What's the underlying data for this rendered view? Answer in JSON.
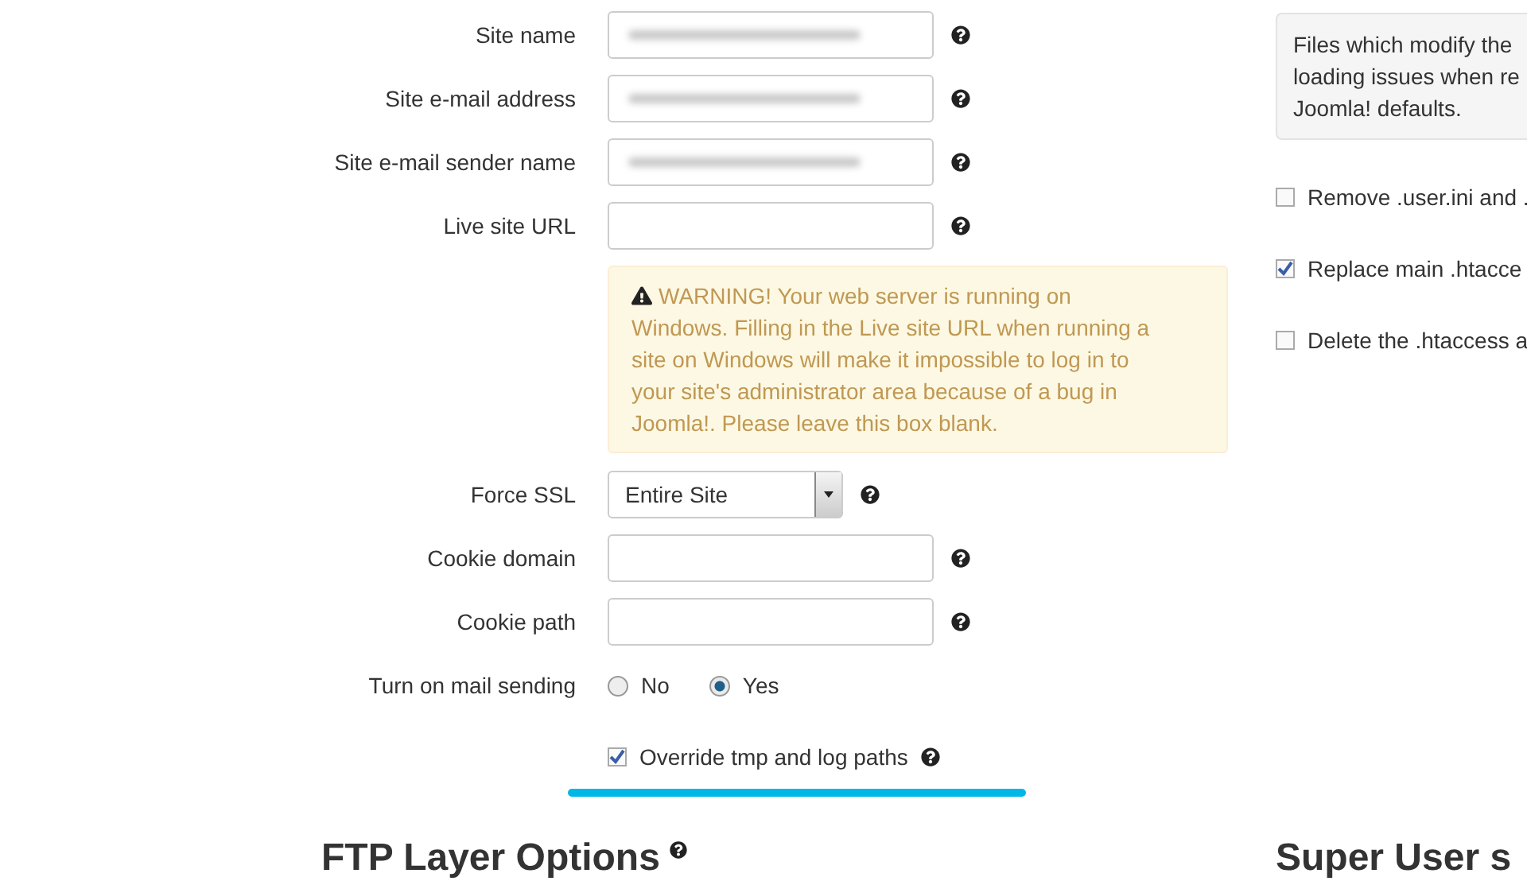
{
  "site_fields": [
    {
      "kind": "text",
      "label": "Site name",
      "blurred": true
    },
    {
      "kind": "text",
      "label": "Site e-mail address",
      "blurred": true
    },
    {
      "kind": "text",
      "label": "Site e-mail sender name",
      "blurred": true
    },
    {
      "kind": "text",
      "label": "Live site URL",
      "blurred": false
    }
  ],
  "warning": {
    "title": "WARNING!",
    "text": "Your web server is running on Windows. Filling in the Live site URL when running a site on Windows will make it impossible to log in to your site's administrator area because of a bug in Joomla!. Please leave this box blank."
  },
  "more_fields": [
    {
      "kind": "select",
      "label": "Force SSL",
      "value": "Entire Site"
    },
    {
      "kind": "text",
      "label": "Cookie domain"
    },
    {
      "kind": "text",
      "label": "Cookie path"
    },
    {
      "kind": "radio",
      "label": "Turn on mail sending",
      "options": [
        {
          "label": "No",
          "selected": false
        },
        {
          "label": "Yes",
          "selected": true
        }
      ]
    }
  ],
  "override": {
    "label": "Override tmp and log paths",
    "checked": true
  },
  "ftp_heading": "FTP Layer Options",
  "info_box": [
    "Files which modify the",
    "loading issues when re",
    "Joomla! defaults."
  ],
  "file_options": [
    {
      "label": "Remove .user.ini and .",
      "checked": false
    },
    {
      "label": "Replace main .htacce",
      "checked": true
    },
    {
      "label": "Delete the .htaccess a",
      "checked": false
    }
  ],
  "super_user_heading": "Super User s"
}
